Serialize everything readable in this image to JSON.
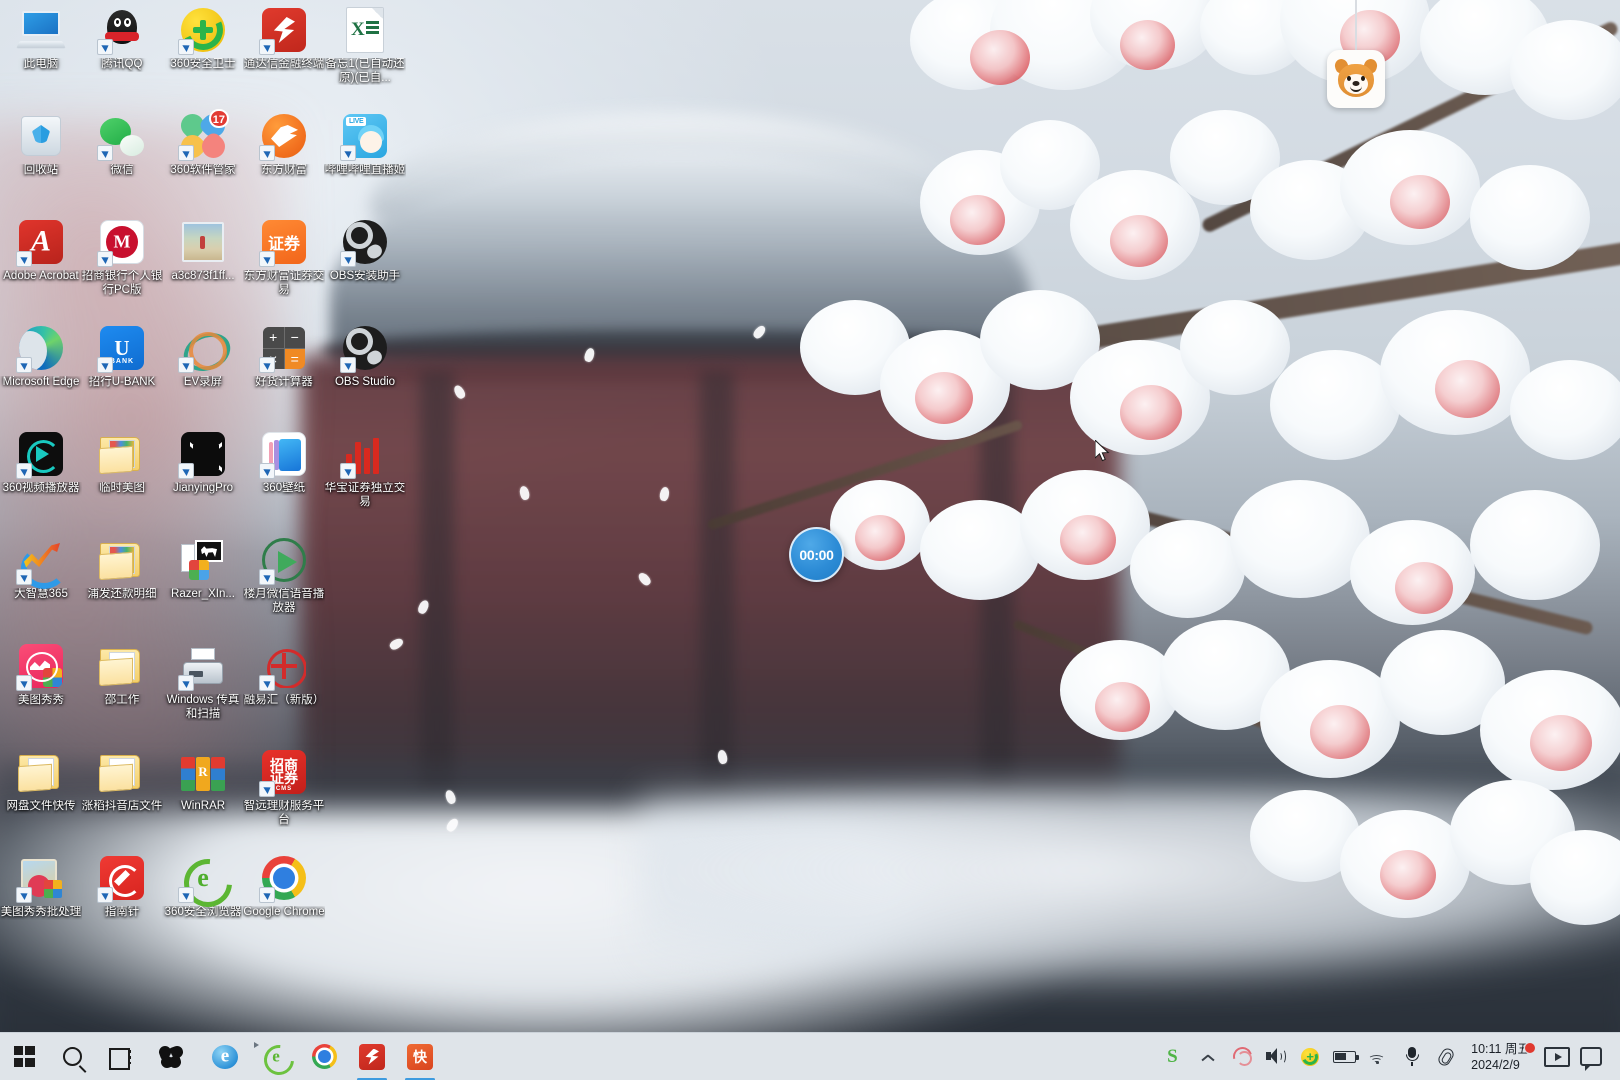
{
  "desktop": {
    "icons": [
      {
        "label": "此电脑",
        "art": "pc",
        "shortcut": false,
        "col": 0,
        "row": 0
      },
      {
        "label": "腾讯QQ",
        "art": "qq",
        "shortcut": true,
        "col": 1,
        "row": 0
      },
      {
        "label": "360安全卫士",
        "art": "safe360",
        "shortcut": true,
        "col": 2,
        "row": 0
      },
      {
        "label": "通达信金融终端",
        "art": "tdx",
        "shortcut": true,
        "col": 3,
        "row": 0
      },
      {
        "label": "备忘1(已自动还原)(已自...",
        "art": "excel",
        "shortcut": false,
        "col": 4,
        "row": 0
      },
      {
        "label": "回收站",
        "art": "recyclebin",
        "shortcut": false,
        "col": 0,
        "row": 1
      },
      {
        "label": "微信",
        "art": "wechat",
        "shortcut": true,
        "col": 1,
        "row": 1
      },
      {
        "label": "360软件管家",
        "art": "soft360",
        "shortcut": true,
        "badge": "17",
        "col": 2,
        "row": 1
      },
      {
        "label": "东方财富",
        "art": "dfcf",
        "shortcut": true,
        "col": 3,
        "row": 1
      },
      {
        "label": "哔哩哔哩直播姬",
        "art": "bilibili",
        "shortcut": true,
        "col": 4,
        "row": 1
      },
      {
        "label": "Adobe Acrobat",
        "art": "acrobat",
        "shortcut": true,
        "col": 0,
        "row": 2
      },
      {
        "label": "招商银行个人银行PC版",
        "art": "cmb",
        "shortcut": true,
        "col": 1,
        "row": 2
      },
      {
        "label": "a3c873f1ff...",
        "art": "photo",
        "shortcut": false,
        "col": 2,
        "row": 2
      },
      {
        "label": "东方财富证券交易",
        "art": "zhengquan",
        "shortcut": true,
        "col": 3,
        "row": 2
      },
      {
        "label": "OBS安装助手",
        "art": "obs",
        "shortcut": true,
        "col": 4,
        "row": 2
      },
      {
        "label": "Microsoft Edge",
        "art": "edge",
        "shortcut": true,
        "col": 0,
        "row": 3
      },
      {
        "label": "招行U-BANK",
        "art": "ubank",
        "shortcut": true,
        "col": 1,
        "row": 3
      },
      {
        "label": "EV录屏",
        "art": "ev",
        "shortcut": true,
        "col": 2,
        "row": 3
      },
      {
        "label": "好货计算器",
        "art": "calc",
        "shortcut": true,
        "col": 3,
        "row": 3
      },
      {
        "label": "OBS Studio",
        "art": "obs",
        "shortcut": true,
        "col": 4,
        "row": 3
      },
      {
        "label": "360视频播放器",
        "art": "video360",
        "shortcut": true,
        "col": 0,
        "row": 4
      },
      {
        "label": "临时美图",
        "art": "folder-color",
        "shortcut": false,
        "col": 1,
        "row": 4
      },
      {
        "label": "JianyingPro",
        "art": "jianying",
        "shortcut": true,
        "col": 2,
        "row": 4
      },
      {
        "label": "360壁纸",
        "art": "wallpaper360",
        "shortcut": true,
        "col": 3,
        "row": 4
      },
      {
        "label": "华宝证券独立交易",
        "art": "stockbars",
        "shortcut": true,
        "col": 4,
        "row": 4
      },
      {
        "label": "大智慧365",
        "art": "dzh",
        "shortcut": true,
        "col": 0,
        "row": 5
      },
      {
        "label": "浦发还款明细",
        "art": "folder-color",
        "shortcut": false,
        "col": 1,
        "row": 5
      },
      {
        "label": "Razer_XIn...",
        "art": "razer",
        "shortcut": false,
        "col": 2,
        "row": 5
      },
      {
        "label": "楼月微信语音播放器",
        "art": "playgreen",
        "shortcut": true,
        "col": 3,
        "row": 5
      },
      {
        "label": "美图秀秀",
        "art": "meitu",
        "shortcut": true,
        "col": 0,
        "row": 6
      },
      {
        "label": "邵工作",
        "art": "folder-doc",
        "shortcut": false,
        "col": 1,
        "row": 6
      },
      {
        "label": "Windows 传真和扫描",
        "art": "fax",
        "shortcut": true,
        "col": 2,
        "row": 6
      },
      {
        "label": "融易汇（新版）",
        "art": "rongyi",
        "shortcut": true,
        "col": 3,
        "row": 6
      },
      {
        "label": "网盘文件快传",
        "art": "folder-doc",
        "shortcut": false,
        "col": 0,
        "row": 7
      },
      {
        "label": "涨稻抖音店文件",
        "art": "folder-doc",
        "shortcut": false,
        "col": 1,
        "row": 7
      },
      {
        "label": "WinRAR",
        "art": "winrar",
        "shortcut": false,
        "col": 2,
        "row": 7
      },
      {
        "label": "智远理财服务平台",
        "art": "zszq",
        "shortcut": true,
        "col": 3,
        "row": 7
      },
      {
        "label": "美图秀秀批处理",
        "art": "meitupipe",
        "shortcut": true,
        "col": 0,
        "row": 8
      },
      {
        "label": "指南针",
        "art": "compass",
        "shortcut": true,
        "col": 1,
        "row": 8
      },
      {
        "label": "360安全浏览器",
        "art": "ie360",
        "shortcut": true,
        "col": 2,
        "row": 8
      },
      {
        "label": "Google Chrome",
        "art": "chrome",
        "shortcut": true,
        "col": 3,
        "row": 8
      }
    ]
  },
  "widgets": {
    "timer": {
      "value": "00:00",
      "accent": "#2d8cd6"
    },
    "shiba": {
      "name": "shiba-inu-pet"
    }
  },
  "taskbar": {
    "start": "start-button",
    "items": [
      {
        "name": "start-button",
        "art": "win",
        "running": false
      },
      {
        "name": "search-button",
        "art": "search",
        "running": false
      },
      {
        "name": "task-view-button",
        "art": "taskview",
        "running": false
      },
      {
        "name": "sogou-input",
        "art": "sogou",
        "running": false
      },
      {
        "name": "internet-explorer",
        "art": "ie",
        "running": false
      },
      {
        "name": "360-browser",
        "art": "ie360",
        "running": false
      },
      {
        "name": "google-chrome",
        "art": "chrome",
        "running": false
      },
      {
        "name": "tdx-terminal",
        "art": "tdx",
        "running": true
      },
      {
        "name": "kuai-app",
        "art": "kuai",
        "running": true
      }
    ],
    "tray": [
      {
        "name": "sogou-tray-icon",
        "art": "sogou"
      },
      {
        "name": "show-hidden-icons-chevron",
        "art": "chevron"
      },
      {
        "name": "wps-tray-icon",
        "art": "wps"
      },
      {
        "name": "volume-icon",
        "art": "volume"
      },
      {
        "name": "360-security-tray-icon",
        "art": "safe360"
      },
      {
        "name": "battery-icon",
        "art": "battery"
      },
      {
        "name": "network-wifi-icon",
        "art": "wifi"
      },
      {
        "name": "microphone-icon",
        "art": "mic"
      },
      {
        "name": "clip-tray-icon",
        "art": "clip"
      }
    ],
    "clock": {
      "time": "10:11",
      "weekday": "周五",
      "date": "2024/2/9",
      "has_badge": true
    },
    "action_center": "action-center-button",
    "notifications": "notifications-button"
  }
}
